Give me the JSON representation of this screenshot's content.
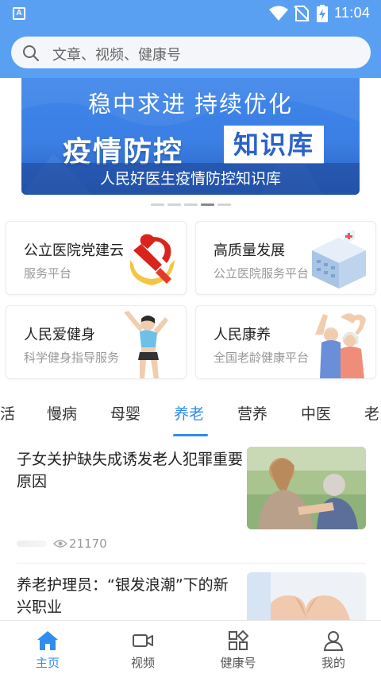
{
  "status_bar": {
    "time": "11:04",
    "app_icon_letter": "A",
    "icons": [
      "app-notification-icon",
      "wifi-icon",
      "no-sim-icon",
      "battery-charging-icon"
    ]
  },
  "search": {
    "placeholder": "文章、视频、健康号",
    "icon": "search-icon"
  },
  "banner": {
    "line1": "稳中求进  持续优化",
    "line2_left": "疫情防控",
    "line2_right": "知识库",
    "caption": "人民好医生疫情防控知识库",
    "dots_count": 5,
    "active_dot": 4
  },
  "services": [
    {
      "title": "公立医院党建云",
      "subtitle": "服务平台",
      "icon": "party-emblem-icon"
    },
    {
      "title": "高质量发展",
      "subtitle": "公立医院服务平台",
      "icon": "hospital-building-icon"
    },
    {
      "title": "人民爱健身",
      "subtitle": "科学健身指导服务",
      "icon": "fitness-woman-icon"
    },
    {
      "title": "人民康养",
      "subtitle": "全国老龄健康平台",
      "icon": "elderly-couple-icon"
    }
  ],
  "tabs": [
    {
      "label": "活"
    },
    {
      "label": "慢病"
    },
    {
      "label": "母婴"
    },
    {
      "label": "养老",
      "active": true
    },
    {
      "label": "营养"
    },
    {
      "label": "中医"
    },
    {
      "label": "老"
    }
  ],
  "news": [
    {
      "title": "子女关护缺失成诱发老人犯罪重要原因",
      "views": "21170",
      "thumb": "elderly-care-photo"
    },
    {
      "title": "养老护理员：“银发浪潮”下的新兴职业",
      "thumb": "heart-hands-photo"
    }
  ],
  "bottom_nav": [
    {
      "label": "主页",
      "icon": "home-icon",
      "active": true
    },
    {
      "label": "视频",
      "icon": "video-camera-icon"
    },
    {
      "label": "健康号",
      "icon": "apps-grid-icon"
    },
    {
      "label": "我的",
      "icon": "person-icon"
    }
  ],
  "colors": {
    "header": "#5aa0f2",
    "accent": "#2f8cf0",
    "party_red": "#d9241c",
    "gold": "#f4c542"
  }
}
